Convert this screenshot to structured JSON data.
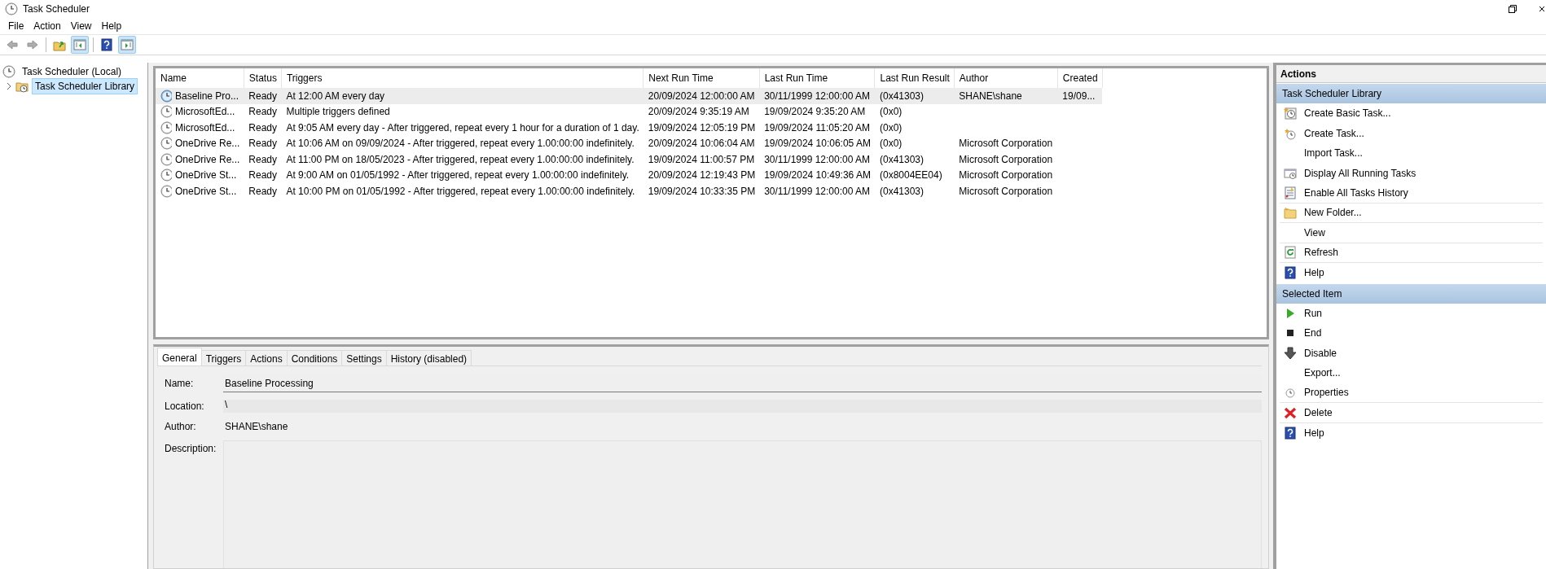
{
  "window": {
    "title": "Task Scheduler"
  },
  "menu": [
    "File",
    "Action",
    "View",
    "Help"
  ],
  "toolbar": [
    {
      "kind": "back",
      "disabled": true,
      "pressed": false
    },
    {
      "kind": "forward",
      "disabled": true,
      "pressed": false
    },
    {
      "kind": "up",
      "disabled": false,
      "pressed": false
    },
    {
      "kind": "tree",
      "disabled": false,
      "pressed": true
    },
    {
      "kind": "help",
      "disabled": false,
      "pressed": false
    },
    {
      "kind": "actions",
      "disabled": false,
      "pressed": true
    }
  ],
  "tree": [
    {
      "label": "Task Scheduler (Local)",
      "selected": false,
      "children": [
        {
          "label": "Task Scheduler Library",
          "selected": true,
          "expanded": false
        }
      ]
    }
  ],
  "table": {
    "columns": [
      "Name",
      "Status",
      "Triggers",
      "Next Run Time",
      "Last Run Time",
      "Last Run Result",
      "Author",
      "Created"
    ],
    "rows": [
      {
        "selected": true,
        "cells": [
          "Baseline Pro...",
          "Ready",
          "At 12:00 AM every day",
          "20/09/2024 12:00:00 AM",
          "30/11/1999 12:00:00 AM",
          "(0x41303)",
          "SHANE\\shane",
          "19/09..."
        ]
      },
      {
        "selected": false,
        "cells": [
          "MicrosoftEd...",
          "Ready",
          "Multiple triggers defined",
          "20/09/2024 9:35:19 AM",
          "19/09/2024 9:35:20 AM",
          "(0x0)",
          "",
          ""
        ]
      },
      {
        "selected": false,
        "cells": [
          "MicrosoftEd...",
          "Ready",
          "At 9:05 AM every day - After triggered, repeat every 1 hour for a duration of 1 day.",
          "19/09/2024 12:05:19 PM",
          "19/09/2024 11:05:20 AM",
          "(0x0)",
          "",
          ""
        ]
      },
      {
        "selected": false,
        "cells": [
          "OneDrive Re...",
          "Ready",
          "At 10:06 AM on 09/09/2024 - After triggered, repeat every 1.00:00:00 indefinitely.",
          "20/09/2024 10:06:04 AM",
          "19/09/2024 10:06:05 AM",
          "(0x0)",
          "Microsoft Corporation",
          ""
        ]
      },
      {
        "selected": false,
        "cells": [
          "OneDrive Re...",
          "Ready",
          "At 11:00 PM on 18/05/2023 - After triggered, repeat every 1.00:00:00 indefinitely.",
          "19/09/2024 11:00:57 PM",
          "30/11/1999 12:00:00 AM",
          "(0x41303)",
          "Microsoft Corporation",
          ""
        ]
      },
      {
        "selected": false,
        "cells": [
          "OneDrive St...",
          "Ready",
          "At 9:00 AM on 01/05/1992 - After triggered, repeat every 1.00:00:00 indefinitely.",
          "20/09/2024 12:19:43 PM",
          "19/09/2024 10:49:36 AM",
          "(0x8004EE04)",
          "Microsoft Corporation",
          ""
        ]
      },
      {
        "selected": false,
        "cells": [
          "OneDrive St...",
          "Ready",
          "At 10:00 PM on 01/05/1992 - After triggered, repeat every 1.00:00:00 indefinitely.",
          "19/09/2024 10:33:35 PM",
          "30/11/1999 12:00:00 AM",
          "(0x41303)",
          "Microsoft Corporation",
          ""
        ]
      }
    ]
  },
  "detail_tabs": [
    {
      "label": "General",
      "selected": true
    },
    {
      "label": "Triggers",
      "selected": false
    },
    {
      "label": "Actions",
      "selected": false
    },
    {
      "label": "Conditions",
      "selected": false
    },
    {
      "label": "Settings",
      "selected": false
    },
    {
      "label": "History (disabled)",
      "selected": false
    }
  ],
  "general": [
    {
      "kind": "textbox",
      "label": "Name:",
      "value": "Baseline Processing"
    },
    {
      "kind": "readonly",
      "label": "Location:",
      "value": "\\"
    },
    {
      "kind": "plain",
      "label": "Author:",
      "value": "SHANE\\shane"
    },
    {
      "kind": "textarea",
      "label": "Description:"
    }
  ],
  "actions": {
    "title": "Actions",
    "sections": [
      {
        "title": "Task Scheduler Library",
        "items": [
          {
            "label": "Create Basic Task..."
          },
          {
            "label": "Create Task..."
          },
          {
            "label": "Import Task..."
          },
          {
            "label": "Display All Running Tasks"
          },
          {
            "label": "Enable All Tasks History"
          },
          {
            "label": "New Folder..."
          },
          {
            "label": "View"
          },
          {
            "label": "Refresh"
          },
          {
            "label": "Help"
          }
        ]
      },
      {
        "title": "Selected Item",
        "items": [
          {
            "label": "Run"
          },
          {
            "label": "End"
          },
          {
            "label": "Disable"
          },
          {
            "label": "Export..."
          },
          {
            "label": "Properties"
          },
          {
            "label": "Delete"
          },
          {
            "label": "Help"
          }
        ]
      }
    ]
  }
}
